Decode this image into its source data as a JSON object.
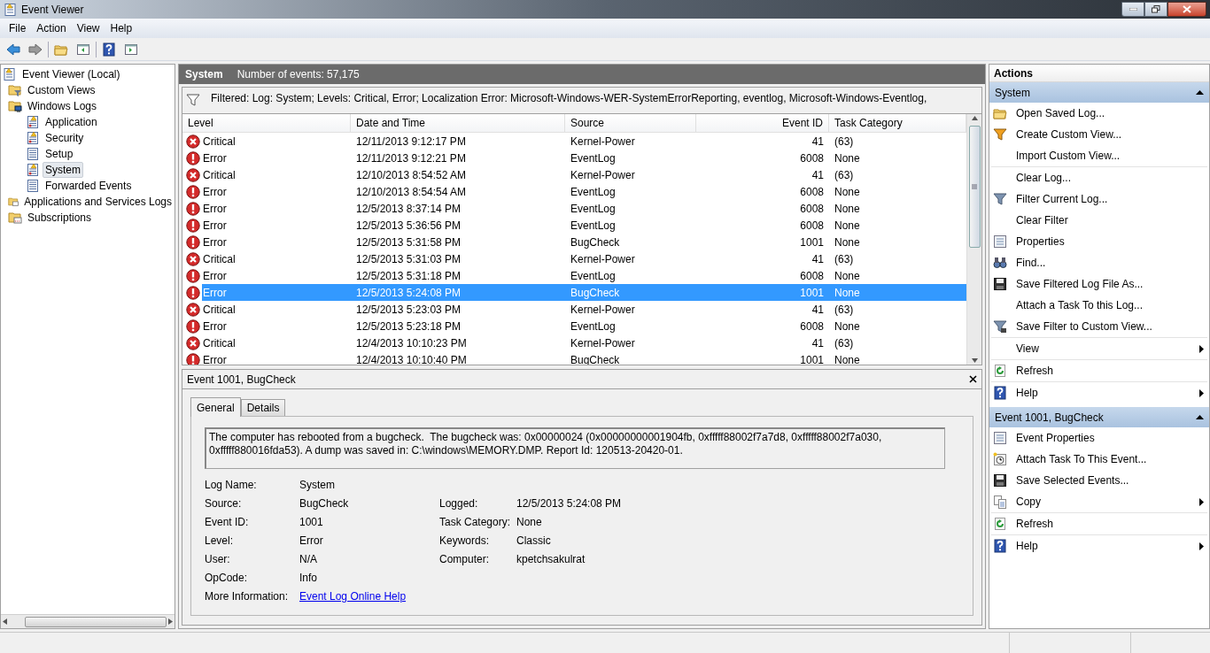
{
  "window": {
    "title": "Event Viewer"
  },
  "menu": [
    "File",
    "Action",
    "View",
    "Help"
  ],
  "toolbar": [
    {
      "kind": "back"
    },
    {
      "kind": "forward"
    },
    {
      "kind": "folder"
    },
    {
      "kind": "pane-left"
    },
    {
      "kind": "help"
    },
    {
      "kind": "pane-right"
    }
  ],
  "tree": [
    {
      "label": "Event Viewer (Local)",
      "kind": "root",
      "selected": false,
      "children": [
        {
          "label": "Custom Views",
          "kind": "folder-filter",
          "selected": false
        },
        {
          "label": "Windows Logs",
          "kind": "folder-pc",
          "selected": false,
          "children": [
            {
              "label": "Application",
              "kind": "log-warn",
              "selected": false
            },
            {
              "label": "Security",
              "kind": "log-warn",
              "selected": false
            },
            {
              "label": "Setup",
              "kind": "log",
              "selected": false
            },
            {
              "label": "System",
              "kind": "log-warn",
              "selected": true
            },
            {
              "label": "Forwarded Events",
              "kind": "log",
              "selected": false
            }
          ]
        },
        {
          "label": "Applications and Services Logs",
          "kind": "folder-doc",
          "selected": false
        },
        {
          "label": "Subscriptions",
          "kind": "folder-sub",
          "selected": false
        }
      ]
    }
  ],
  "log_header": {
    "name": "System",
    "count": "Number of events: 57,175"
  },
  "filter": "Filtered: Log: System; Levels: Critical, Error; Localization Error: Microsoft-Windows-WER-SystemErrorReporting, eventlog, Microsoft-Windows-Eventlog,",
  "table": {
    "columns": [
      "Level",
      "Date and Time",
      "Source",
      "Event ID",
      "Task Category"
    ],
    "rows": [
      {
        "kind": "critical",
        "level": "Critical",
        "date": "12/11/2013 9:12:17 PM",
        "source": "Kernel-Power",
        "event_id": "41",
        "task_category": "(63)",
        "selected": false
      },
      {
        "kind": "error",
        "level": "Error",
        "date": "12/11/2013 9:12:21 PM",
        "source": "EventLog",
        "event_id": "6008",
        "task_category": "None",
        "selected": false
      },
      {
        "kind": "critical",
        "level": "Critical",
        "date": "12/10/2013 8:54:52 AM",
        "source": "Kernel-Power",
        "event_id": "41",
        "task_category": "(63)",
        "selected": false
      },
      {
        "kind": "error",
        "level": "Error",
        "date": "12/10/2013 8:54:54 AM",
        "source": "EventLog",
        "event_id": "6008",
        "task_category": "None",
        "selected": false
      },
      {
        "kind": "error",
        "level": "Error",
        "date": "12/5/2013 8:37:14 PM",
        "source": "EventLog",
        "event_id": "6008",
        "task_category": "None",
        "selected": false
      },
      {
        "kind": "error",
        "level": "Error",
        "date": "12/5/2013 5:36:56 PM",
        "source": "EventLog",
        "event_id": "6008",
        "task_category": "None",
        "selected": false
      },
      {
        "kind": "error",
        "level": "Error",
        "date": "12/5/2013 5:31:58 PM",
        "source": "BugCheck",
        "event_id": "1001",
        "task_category": "None",
        "selected": false
      },
      {
        "kind": "critical",
        "level": "Critical",
        "date": "12/5/2013 5:31:03 PM",
        "source": "Kernel-Power",
        "event_id": "41",
        "task_category": "(63)",
        "selected": false
      },
      {
        "kind": "error",
        "level": "Error",
        "date": "12/5/2013 5:31:18 PM",
        "source": "EventLog",
        "event_id": "6008",
        "task_category": "None",
        "selected": false
      },
      {
        "kind": "error",
        "level": "Error",
        "date": "12/5/2013 5:24:08 PM",
        "source": "BugCheck",
        "event_id": "1001",
        "task_category": "None",
        "selected": true
      },
      {
        "kind": "critical",
        "level": "Critical",
        "date": "12/5/2013 5:23:03 PM",
        "source": "Kernel-Power",
        "event_id": "41",
        "task_category": "(63)",
        "selected": false
      },
      {
        "kind": "error",
        "level": "Error",
        "date": "12/5/2013 5:23:18 PM",
        "source": "EventLog",
        "event_id": "6008",
        "task_category": "None",
        "selected": false
      },
      {
        "kind": "critical",
        "level": "Critical",
        "date": "12/4/2013 10:10:23 PM",
        "source": "Kernel-Power",
        "event_id": "41",
        "task_category": "(63)",
        "selected": false
      },
      {
        "kind": "error",
        "level": "Error",
        "date": "12/4/2013 10:10:40 PM",
        "source": "BugCheck",
        "event_id": "1001",
        "task_category": "None",
        "selected": false
      }
    ]
  },
  "detail": {
    "title": "Event 1001, BugCheck",
    "tabs": [
      {
        "label": "General",
        "selected": true
      },
      {
        "label": "Details",
        "selected": false
      }
    ],
    "description": "The computer has rebooted from a bugcheck.  The bugcheck was: 0x00000024 (0x00000000001904fb, 0xfffff88002f7a7d8, 0xfffff88002f7a030, 0xfffff880016fda53). A dump was saved in: C:\\windows\\MEMORY.DMP. Report Id: 120513-20420-01.",
    "fields": [
      [
        {
          "label": "Log Name:",
          "value": "System"
        }
      ],
      [
        {
          "label": "Source:",
          "value": "BugCheck"
        },
        {
          "label": "Logged:",
          "value": "12/5/2013 5:24:08 PM"
        }
      ],
      [
        {
          "label": "Event ID:",
          "value": "1001"
        },
        {
          "label": "Task Category:",
          "value": "None"
        }
      ],
      [
        {
          "label": "Level:",
          "value": "Error"
        },
        {
          "label": "Keywords:",
          "value": "Classic"
        }
      ],
      [
        {
          "label": "User:",
          "value": "N/A"
        },
        {
          "label": "Computer:",
          "value": "kpetchsakulrat"
        }
      ],
      [
        {
          "label": "OpCode:",
          "value": "Info"
        }
      ]
    ],
    "more_info": {
      "label": "More Information:",
      "link": "Event Log Online Help"
    }
  },
  "actions": {
    "title": "Actions",
    "sections": [
      {
        "title": "System",
        "groups": [
          [
            {
              "label": "Open Saved Log...",
              "kind": "folder",
              "submenu": false
            },
            {
              "label": "Create Custom View...",
              "kind": "funnel-color",
              "submenu": false
            },
            {
              "label": "Import Custom View...",
              "kind": "plain",
              "submenu": false
            }
          ],
          [
            {
              "label": "Clear Log...",
              "kind": "plain",
              "submenu": false
            },
            {
              "label": "Filter Current Log...",
              "kind": "funnel",
              "submenu": false
            },
            {
              "label": "Clear Filter",
              "kind": "plain",
              "submenu": false
            },
            {
              "label": "Properties",
              "kind": "properties",
              "submenu": false
            },
            {
              "label": "Find...",
              "kind": "binoculars",
              "submenu": false
            },
            {
              "label": "Save Filtered Log File As...",
              "kind": "disk",
              "submenu": false
            },
            {
              "label": "Attach a Task To this Log...",
              "kind": "plain",
              "submenu": false
            },
            {
              "label": "Save Filter to Custom View...",
              "kind": "funnel-save",
              "submenu": false
            }
          ],
          [
            {
              "label": "View",
              "kind": "plain",
              "submenu": true
            }
          ],
          [
            {
              "label": "Refresh",
              "kind": "refresh",
              "submenu": false
            }
          ],
          [
            {
              "label": "Help",
              "kind": "help",
              "submenu": true
            }
          ]
        ]
      },
      {
        "title": "Event 1001, BugCheck",
        "groups": [
          [
            {
              "label": "Event Properties",
              "kind": "properties",
              "submenu": false
            },
            {
              "label": "Attach Task To This Event...",
              "kind": "clock",
              "submenu": false
            },
            {
              "label": "Save Selected Events...",
              "kind": "disk",
              "submenu": false
            },
            {
              "label": "Copy",
              "kind": "copy",
              "submenu": true
            }
          ],
          [
            {
              "label": "Refresh",
              "kind": "refresh",
              "submenu": false
            }
          ],
          [
            {
              "label": "Help",
              "kind": "help",
              "submenu": true
            }
          ]
        ]
      }
    ]
  }
}
